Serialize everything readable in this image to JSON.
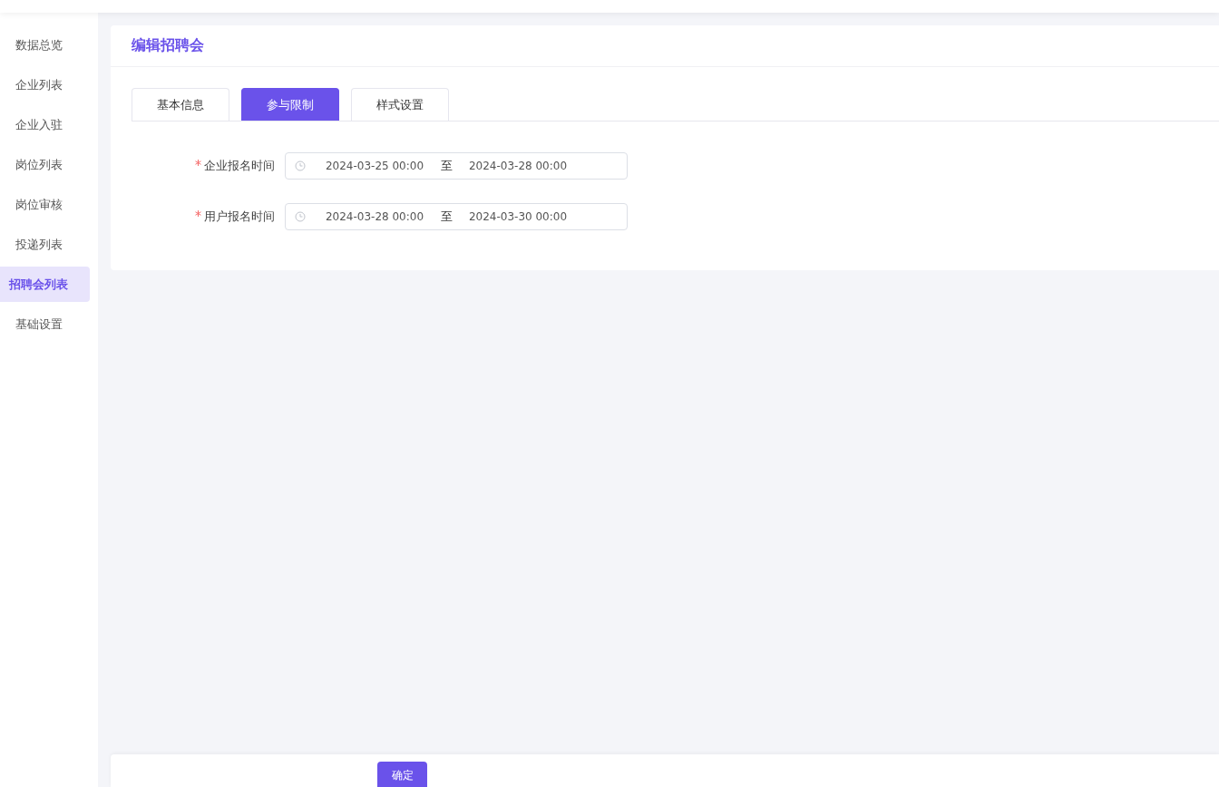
{
  "sidebar": {
    "items": [
      {
        "label": "数据总览",
        "selected": false
      },
      {
        "label": "企业列表",
        "selected": false
      },
      {
        "label": "企业入驻",
        "selected": false
      },
      {
        "label": "岗位列表",
        "selected": false
      },
      {
        "label": "岗位审核",
        "selected": false
      },
      {
        "label": "投递列表",
        "selected": false
      },
      {
        "label": "招聘会列表",
        "selected": true
      },
      {
        "label": "基础设置",
        "selected": false
      }
    ]
  },
  "card": {
    "title": "编辑招聘会",
    "tabs": [
      {
        "label": "基本信息",
        "selected": false
      },
      {
        "label": "参与限制",
        "selected": true
      },
      {
        "label": "样式设置",
        "selected": false
      }
    ],
    "fields": [
      {
        "label": "企业报名时间",
        "required": true,
        "start": "2024-03-25 00:00",
        "separator": "至",
        "end": "2024-03-28 00:00"
      },
      {
        "label": "用户报名时间",
        "required": true,
        "start": "2024-03-28 00:00",
        "separator": "至",
        "end": "2024-03-30 00:00"
      }
    ]
  },
  "footer": {
    "button": "确定"
  }
}
